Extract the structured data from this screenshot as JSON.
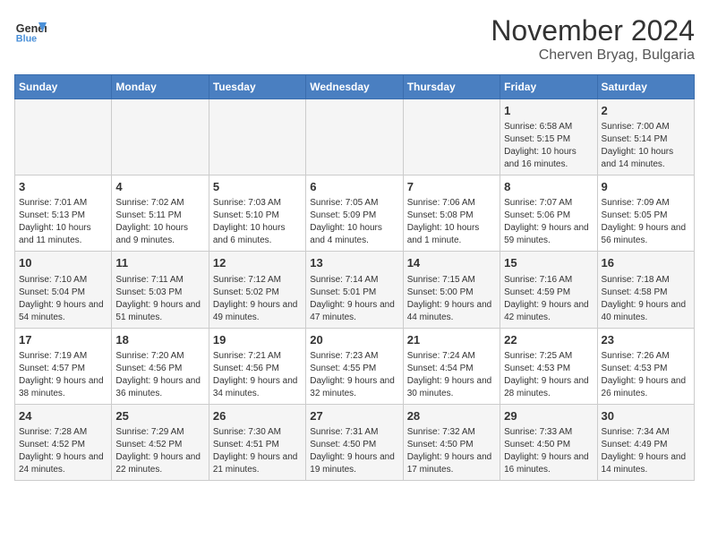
{
  "header": {
    "logo_line1": "General",
    "logo_line2": "Blue",
    "month": "November 2024",
    "location": "Cherven Bryag, Bulgaria"
  },
  "weekdays": [
    "Sunday",
    "Monday",
    "Tuesday",
    "Wednesday",
    "Thursday",
    "Friday",
    "Saturday"
  ],
  "weeks": [
    [
      {
        "day": "",
        "info": ""
      },
      {
        "day": "",
        "info": ""
      },
      {
        "day": "",
        "info": ""
      },
      {
        "day": "",
        "info": ""
      },
      {
        "day": "",
        "info": ""
      },
      {
        "day": "1",
        "info": "Sunrise: 6:58 AM\nSunset: 5:15 PM\nDaylight: 10 hours and 16 minutes."
      },
      {
        "day": "2",
        "info": "Sunrise: 7:00 AM\nSunset: 5:14 PM\nDaylight: 10 hours and 14 minutes."
      }
    ],
    [
      {
        "day": "3",
        "info": "Sunrise: 7:01 AM\nSunset: 5:13 PM\nDaylight: 10 hours and 11 minutes."
      },
      {
        "day": "4",
        "info": "Sunrise: 7:02 AM\nSunset: 5:11 PM\nDaylight: 10 hours and 9 minutes."
      },
      {
        "day": "5",
        "info": "Sunrise: 7:03 AM\nSunset: 5:10 PM\nDaylight: 10 hours and 6 minutes."
      },
      {
        "day": "6",
        "info": "Sunrise: 7:05 AM\nSunset: 5:09 PM\nDaylight: 10 hours and 4 minutes."
      },
      {
        "day": "7",
        "info": "Sunrise: 7:06 AM\nSunset: 5:08 PM\nDaylight: 10 hours and 1 minute."
      },
      {
        "day": "8",
        "info": "Sunrise: 7:07 AM\nSunset: 5:06 PM\nDaylight: 9 hours and 59 minutes."
      },
      {
        "day": "9",
        "info": "Sunrise: 7:09 AM\nSunset: 5:05 PM\nDaylight: 9 hours and 56 minutes."
      }
    ],
    [
      {
        "day": "10",
        "info": "Sunrise: 7:10 AM\nSunset: 5:04 PM\nDaylight: 9 hours and 54 minutes."
      },
      {
        "day": "11",
        "info": "Sunrise: 7:11 AM\nSunset: 5:03 PM\nDaylight: 9 hours and 51 minutes."
      },
      {
        "day": "12",
        "info": "Sunrise: 7:12 AM\nSunset: 5:02 PM\nDaylight: 9 hours and 49 minutes."
      },
      {
        "day": "13",
        "info": "Sunrise: 7:14 AM\nSunset: 5:01 PM\nDaylight: 9 hours and 47 minutes."
      },
      {
        "day": "14",
        "info": "Sunrise: 7:15 AM\nSunset: 5:00 PM\nDaylight: 9 hours and 44 minutes."
      },
      {
        "day": "15",
        "info": "Sunrise: 7:16 AM\nSunset: 4:59 PM\nDaylight: 9 hours and 42 minutes."
      },
      {
        "day": "16",
        "info": "Sunrise: 7:18 AM\nSunset: 4:58 PM\nDaylight: 9 hours and 40 minutes."
      }
    ],
    [
      {
        "day": "17",
        "info": "Sunrise: 7:19 AM\nSunset: 4:57 PM\nDaylight: 9 hours and 38 minutes."
      },
      {
        "day": "18",
        "info": "Sunrise: 7:20 AM\nSunset: 4:56 PM\nDaylight: 9 hours and 36 minutes."
      },
      {
        "day": "19",
        "info": "Sunrise: 7:21 AM\nSunset: 4:56 PM\nDaylight: 9 hours and 34 minutes."
      },
      {
        "day": "20",
        "info": "Sunrise: 7:23 AM\nSunset: 4:55 PM\nDaylight: 9 hours and 32 minutes."
      },
      {
        "day": "21",
        "info": "Sunrise: 7:24 AM\nSunset: 4:54 PM\nDaylight: 9 hours and 30 minutes."
      },
      {
        "day": "22",
        "info": "Sunrise: 7:25 AM\nSunset: 4:53 PM\nDaylight: 9 hours and 28 minutes."
      },
      {
        "day": "23",
        "info": "Sunrise: 7:26 AM\nSunset: 4:53 PM\nDaylight: 9 hours and 26 minutes."
      }
    ],
    [
      {
        "day": "24",
        "info": "Sunrise: 7:28 AM\nSunset: 4:52 PM\nDaylight: 9 hours and 24 minutes."
      },
      {
        "day": "25",
        "info": "Sunrise: 7:29 AM\nSunset: 4:52 PM\nDaylight: 9 hours and 22 minutes."
      },
      {
        "day": "26",
        "info": "Sunrise: 7:30 AM\nSunset: 4:51 PM\nDaylight: 9 hours and 21 minutes."
      },
      {
        "day": "27",
        "info": "Sunrise: 7:31 AM\nSunset: 4:50 PM\nDaylight: 9 hours and 19 minutes."
      },
      {
        "day": "28",
        "info": "Sunrise: 7:32 AM\nSunset: 4:50 PM\nDaylight: 9 hours and 17 minutes."
      },
      {
        "day": "29",
        "info": "Sunrise: 7:33 AM\nSunset: 4:50 PM\nDaylight: 9 hours and 16 minutes."
      },
      {
        "day": "30",
        "info": "Sunrise: 7:34 AM\nSunset: 4:49 PM\nDaylight: 9 hours and 14 minutes."
      }
    ]
  ]
}
